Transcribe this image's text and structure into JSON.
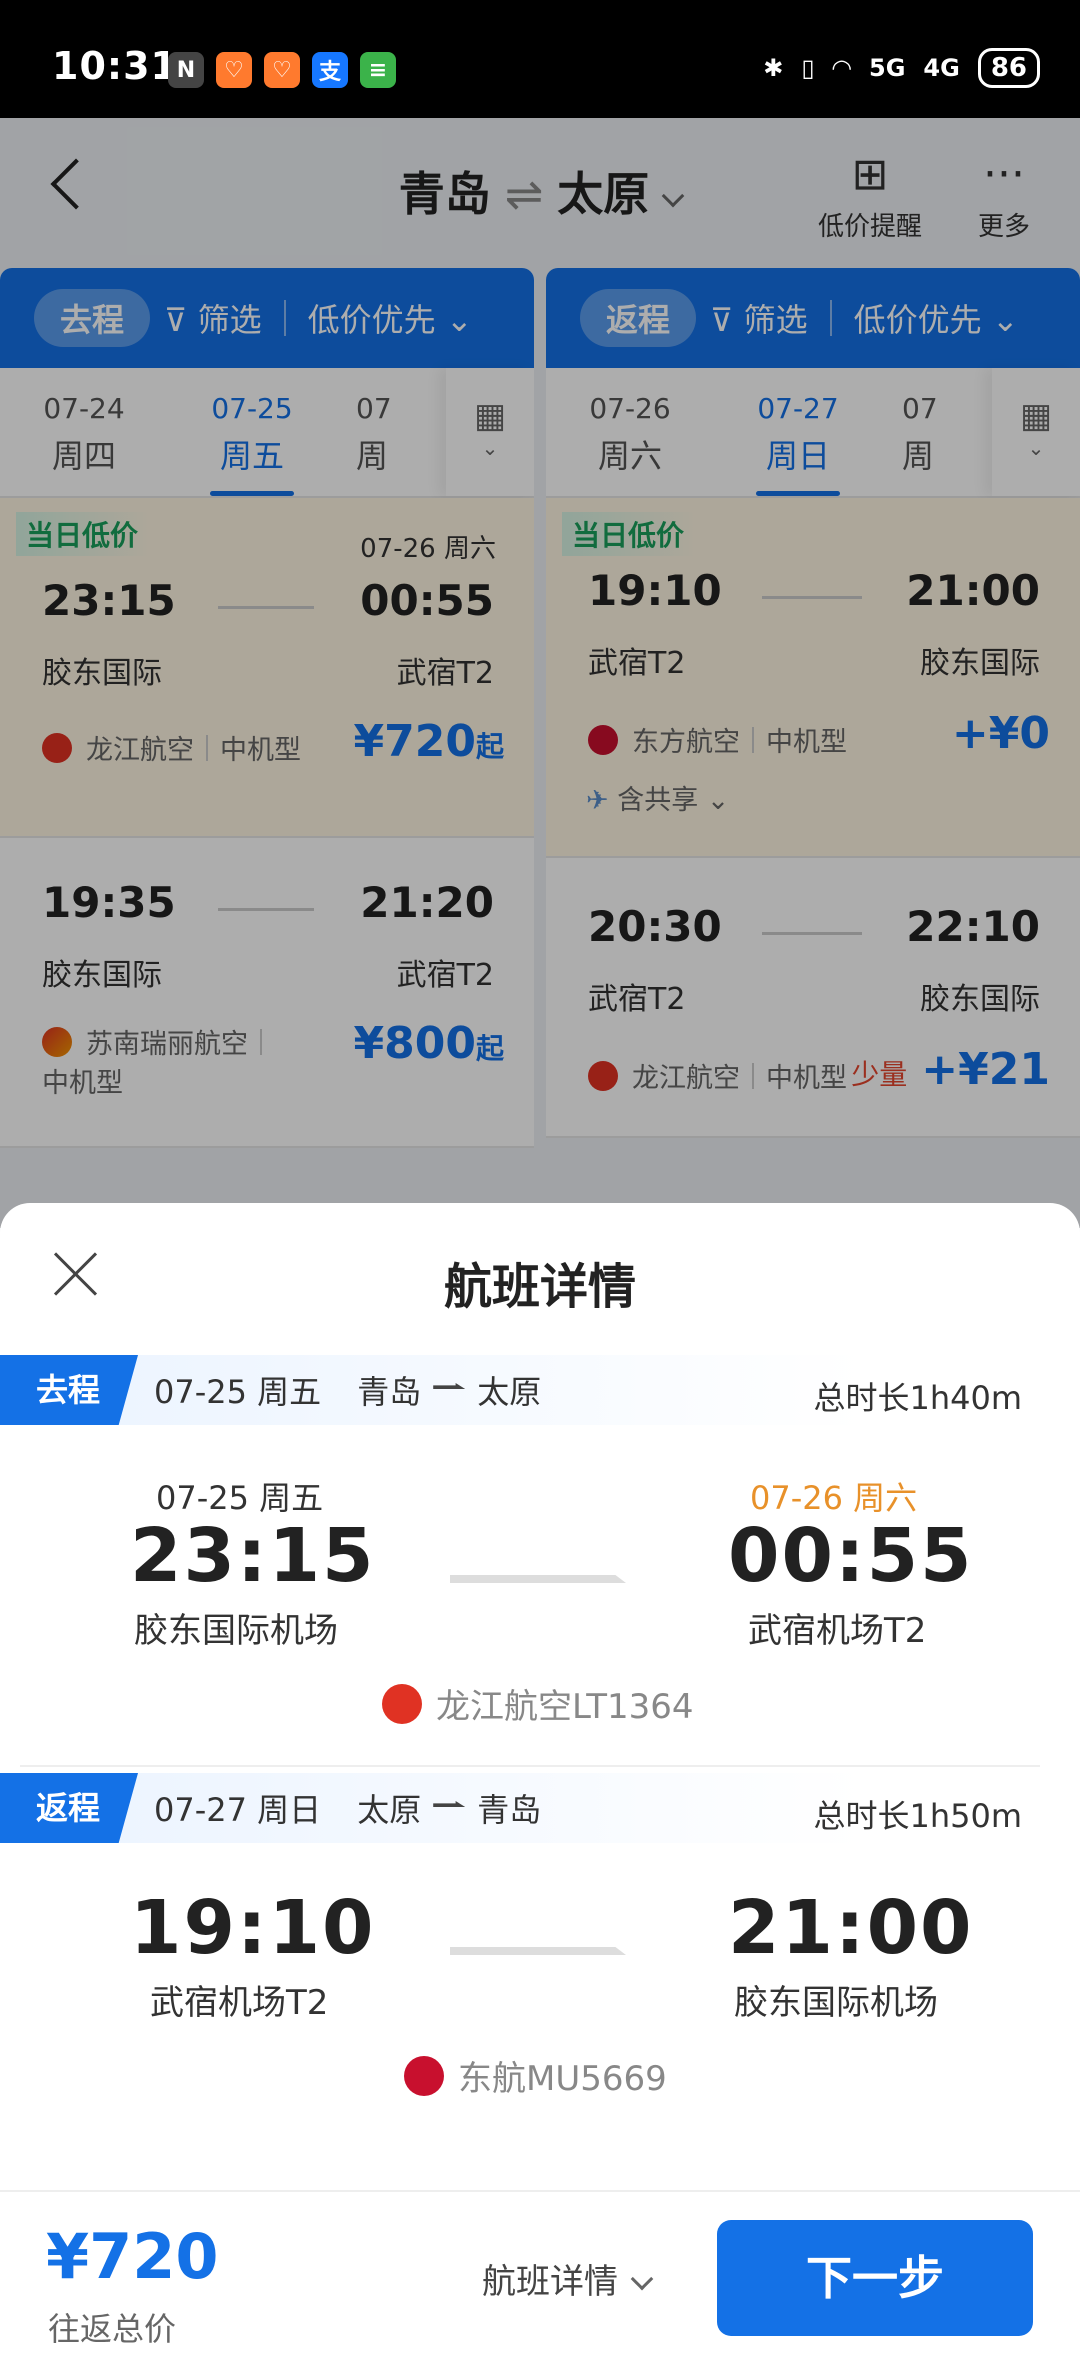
{
  "status_bar": {
    "time": "10:31",
    "battery": "86",
    "signal_1": "5G",
    "signal_2": "4G",
    "app_icons": [
      "N",
      "♡",
      "♡",
      "支",
      "≡"
    ]
  },
  "header": {
    "from": "青岛",
    "to": "太原",
    "swap_symbol": "⇌",
    "low_price_alert": "低价提醒",
    "more": "更多"
  },
  "outbound_panel": {
    "label": "去程",
    "filter": "筛选",
    "sort": "低价优先",
    "dates": [
      {
        "date": "07-24",
        "day": "周四"
      },
      {
        "date": "07-25",
        "day": "周五"
      },
      {
        "date": "07",
        "day": "周"
      }
    ],
    "flights": [
      {
        "tag": "当日低价",
        "next_day": "07-26 周六",
        "dep": "23:15",
        "arr": "00:55",
        "dep_ap": "胶东国际",
        "arr_ap": "武宿T2",
        "airline": "龙江航空",
        "plane": "中机型",
        "price": "¥720",
        "suffix": "起"
      },
      {
        "dep": "19:35",
        "arr": "21:20",
        "dep_ap": "胶东国际",
        "arr_ap": "武宿T2",
        "airline": "苏南瑞丽航空",
        "plane": "中机型",
        "price": "¥800",
        "suffix": "起"
      }
    ]
  },
  "return_panel": {
    "label": "返程",
    "filter": "筛选",
    "sort": "低价优先",
    "dates": [
      {
        "date": "07-26",
        "day": "周六"
      },
      {
        "date": "07-27",
        "day": "周日"
      },
      {
        "date": "07",
        "day": "周"
      }
    ],
    "flights": [
      {
        "tag": "当日低价",
        "dep": "19:10",
        "arr": "21:00",
        "dep_ap": "武宿T2",
        "arr_ap": "胶东国际",
        "airline": "东方航空",
        "plane": "中机型",
        "price": "+¥0",
        "share": "含共享"
      },
      {
        "dep": "20:30",
        "arr": "22:10",
        "dep_ap": "武宿T2",
        "arr_ap": "胶东国际",
        "airline": "龙江航空",
        "plane": "中机型",
        "qty": "少量",
        "price": "+¥21"
      }
    ]
  },
  "sheet": {
    "title": "航班详情",
    "outbound": {
      "tag": "去程",
      "date": "07-25 周五",
      "from": "青岛",
      "to": "太原",
      "duration": "总时长1h40m",
      "dep_date": "07-25 周五",
      "arr_date": "07-26 周六",
      "dep": "23:15",
      "arr": "00:55",
      "dep_ap": "胶东国际机场",
      "arr_ap": "武宿机场T2",
      "flight": "龙江航空LT1364"
    },
    "return": {
      "tag": "返程",
      "date": "07-27 周日",
      "from": "太原",
      "to": "青岛",
      "duration": "总时长1h50m",
      "dep": "19:10",
      "arr": "21:00",
      "dep_ap": "武宿机场T2",
      "arr_ap": "胶东国际机场",
      "flight": "东航MU5669"
    }
  },
  "footer": {
    "total_price": "¥720",
    "total_label": "往返总价",
    "details": "航班详情",
    "next": "下一步"
  },
  "colors": {
    "accent": "#1471e6",
    "low_tag": "#1aa05c",
    "orange": "#e8912a"
  }
}
